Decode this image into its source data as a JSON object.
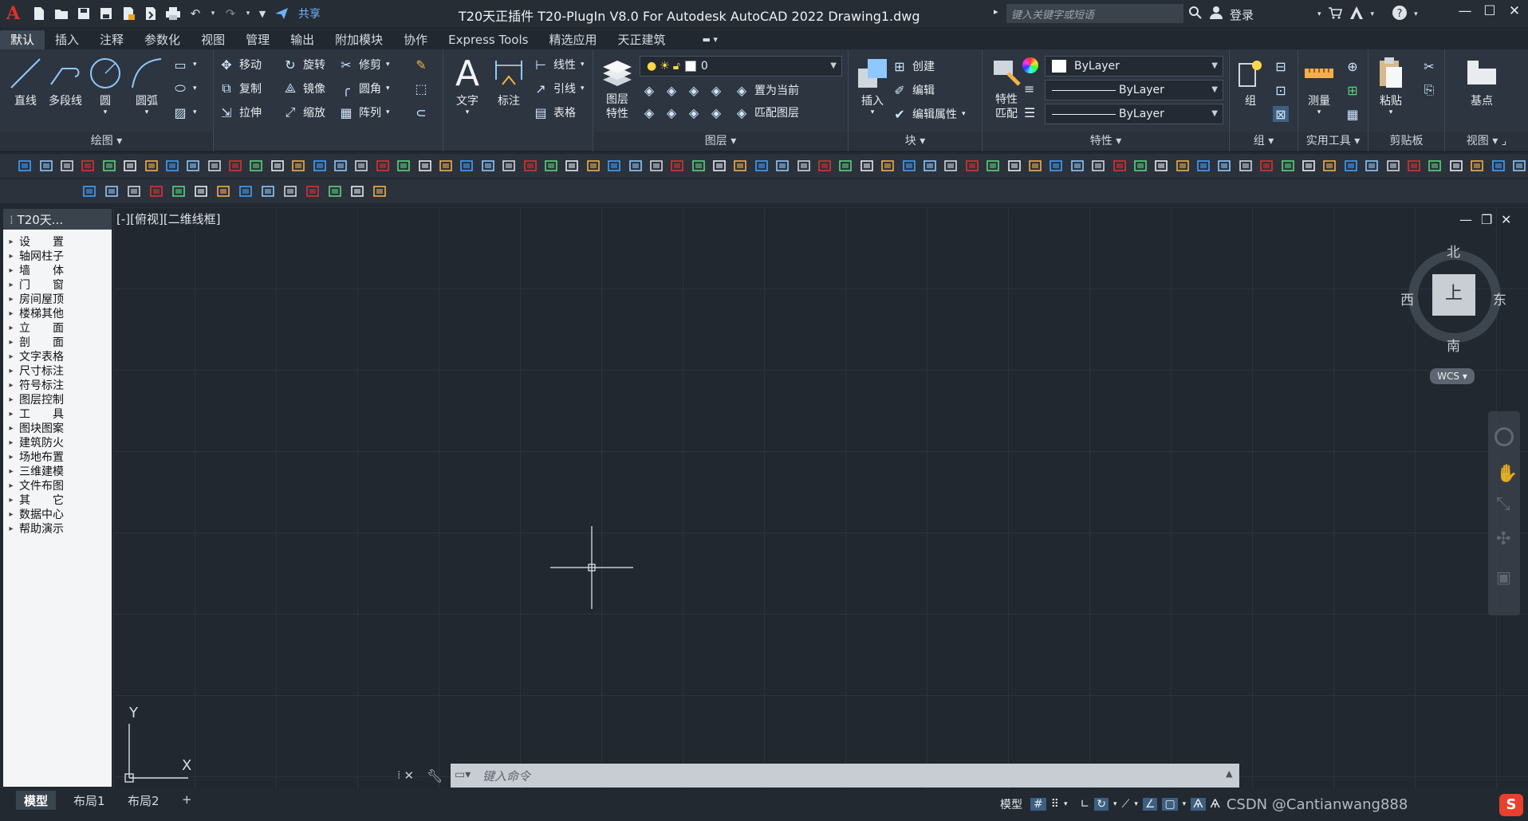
{
  "titlebar": {
    "logo": "A",
    "share_label": "共享",
    "title": "T20天正插件 T20-PlugIn V8.0 For Autodesk AutoCAD 2022    Drawing1.dwg",
    "search_placeholder": "键入关键字或短语",
    "login_label": "登录"
  },
  "tabs": [
    "默认",
    "插入",
    "注释",
    "参数化",
    "视图",
    "管理",
    "输出",
    "附加模块",
    "协作",
    "Express Tools",
    "精选应用",
    "天正建筑"
  ],
  "ribbon": {
    "draw": {
      "title": "绘图",
      "line": "直线",
      "polyline": "多段线",
      "circle": "圆",
      "arc": "圆弧"
    },
    "modify": {
      "move": "移动",
      "rotate": "旋转",
      "trim": "修剪",
      "copy": "复制",
      "mirror": "镜像",
      "fillet": "圆角",
      "stretch": "拉伸",
      "scale": "缩放",
      "array": "阵列"
    },
    "annotation": {
      "text": "文字",
      "dimension": "标注",
      "linear": "线性",
      "leader": "引线",
      "table": "表格"
    },
    "layers": {
      "title": "图层",
      "properties": "图层特性",
      "current_layer": "0",
      "make_current": "置为当前",
      "match_layer": "匹配图层"
    },
    "block": {
      "title": "块",
      "insert": "插入",
      "create": "创建",
      "edit": "编辑",
      "edit_attr": "编辑属性"
    },
    "properties": {
      "title": "特性",
      "match": "特性匹配",
      "color": "ByLayer",
      "linetype": "ByLayer",
      "lineweight": "ByLayer"
    },
    "groups": {
      "title": "组",
      "group": "组"
    },
    "utilities": {
      "title": "实用工具",
      "measure": "测量"
    },
    "clipboard": {
      "title": "剪贴板",
      "paste": "粘贴"
    },
    "view": {
      "title": "视图",
      "base": "基点"
    }
  },
  "palette": {
    "title": "T20天...",
    "items": [
      "设　　置",
      "轴网柱子",
      "墙　　体",
      "门　　窗",
      "房间屋顶",
      "楼梯其他",
      "立　　面",
      "剖　　面",
      "文字表格",
      "尺寸标注",
      "符号标注",
      "图层控制",
      "工　　具",
      "图块图案",
      "建筑防火",
      "场地布置",
      "三维建模",
      "文件布图",
      "其　　它",
      "数据中心",
      "帮助演示"
    ]
  },
  "viewport": {
    "label": "[-][俯视][二维线框]",
    "viewcube": {
      "north": "北",
      "south": "南",
      "east": "东",
      "west": "西",
      "top": "上",
      "wcs": "WCS"
    },
    "ucs": {
      "x": "X",
      "y": "Y"
    }
  },
  "command": {
    "placeholder": "键入命令"
  },
  "layouts": [
    "模型",
    "布局1",
    "布局2"
  ],
  "status": {
    "model": "模型",
    "watermark": "CSDN @Cantianwang888"
  }
}
